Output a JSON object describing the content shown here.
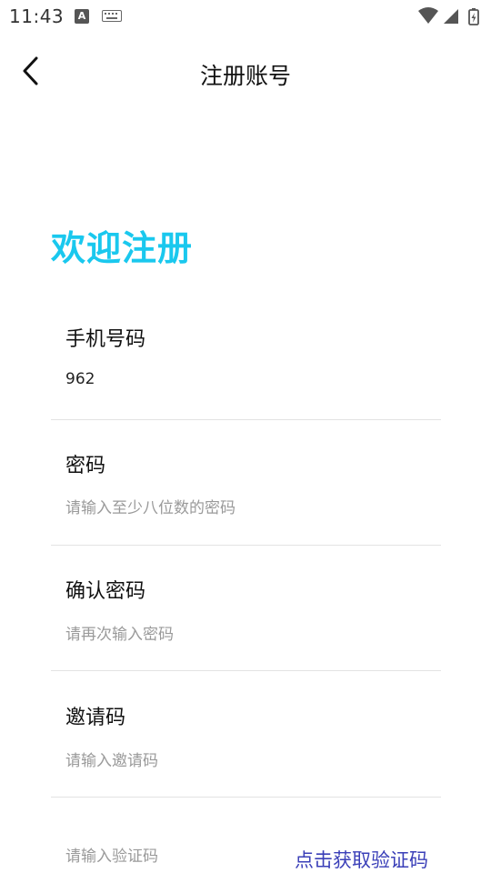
{
  "status_bar": {
    "time": "11:43",
    "a_glyph": "A",
    "icons": [
      "a-notification-icon",
      "keyboard-icon",
      "wifi-icon",
      "signal-icon",
      "battery-charging-icon"
    ]
  },
  "header": {
    "title": "注册账号",
    "back_icon": "chevron-left-icon"
  },
  "welcome_text": "欢迎注册",
  "colors": {
    "accent": "#1ac8ee",
    "link": "#3a3fb8",
    "divider": "#e3e3e3",
    "placeholder": "#9a9a9a"
  },
  "form": {
    "phone": {
      "label": "手机号码",
      "value": "962",
      "placeholder": ""
    },
    "password": {
      "label": "密码",
      "value": "",
      "placeholder": "请输入至少八位数的密码"
    },
    "confirm_password": {
      "label": "确认密码",
      "value": "",
      "placeholder": "请再次输入密码"
    },
    "invite_code": {
      "label": "邀请码",
      "value": "",
      "placeholder": "请输入邀请码"
    },
    "verification": {
      "placeholder": "请输入验证码",
      "button_label": "点击获取验证码"
    }
  }
}
